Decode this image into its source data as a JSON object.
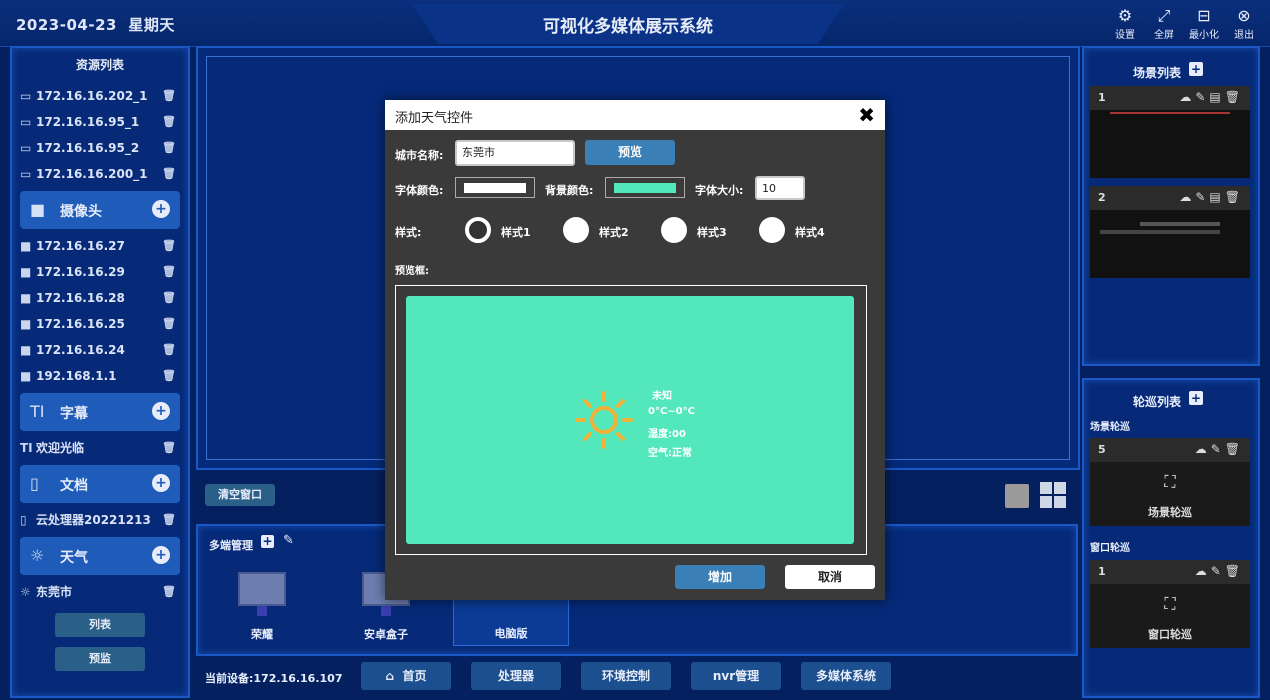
{
  "header": {
    "date": "2023-04-23",
    "weekday": "星期天",
    "title": "可视化多媒体展示系统",
    "buttons": [
      {
        "label": "设置",
        "icon": "gear-icon"
      },
      {
        "label": "全屏",
        "icon": "fullscreen-icon"
      },
      {
        "label": "最小化",
        "icon": "minimize-icon"
      },
      {
        "label": "退出",
        "icon": "close-icon"
      }
    ]
  },
  "left": {
    "title": "资源列表",
    "devices": [
      "172.16.16.202_1",
      "172.16.16.95_1",
      "172.16.16.95_2",
      "172.16.16.200_1"
    ],
    "camera_label": "摄像头",
    "cameras": [
      "172.16.16.27",
      "172.16.16.29",
      "172.16.16.28",
      "172.16.16.25",
      "172.16.16.24",
      "192.168.1.1"
    ],
    "subtitle_label": "字幕",
    "subtitles": [
      "欢迎光临"
    ],
    "doc_label": "文档",
    "docs": [
      "云处理器20221213"
    ],
    "weather_label": "天气",
    "weathers": [
      "东莞市"
    ],
    "list_btn": "列表",
    "preview_btn": "预监"
  },
  "center": {
    "clear_btn": "清空窗口",
    "multi_title": "多端管理",
    "devices": [
      "荣耀",
      "安卓盒子",
      "电脑版"
    ],
    "current_device": "当前设备:172.16.16.107"
  },
  "nav": [
    "首页",
    "处理器",
    "环境控制",
    "nvr管理",
    "多媒体系统"
  ],
  "dialog": {
    "title": "添加天气控件",
    "city_label": "城市名称:",
    "city_value": "东莞市",
    "preview_btn": "预览",
    "font_color_label": "字体颜色:",
    "font_color": "#ffffff",
    "bg_color_label": "背景颜色:",
    "bg_color": "#52e8bb",
    "font_size_label": "字体大小:",
    "font_size": "10",
    "style_label": "样式:",
    "styles": [
      "样式1",
      "样式2",
      "样式3",
      "样式4"
    ],
    "selected_style": 0,
    "preview_frame_label": "预览框:",
    "weather": {
      "condition": "未知",
      "temp": "0°C~0°C",
      "humidity": "湿度:00",
      "air": "空气:正常"
    },
    "add_btn": "增加",
    "cancel_btn": "取消"
  },
  "right": {
    "scene_title": "场景列表",
    "scenes": [
      "1",
      "2"
    ],
    "tour_title": "轮巡列表",
    "scene_tour_label": "场景轮巡",
    "scene_tour_num": "5",
    "scene_tour_name": "场景轮巡",
    "window_tour_label": "窗口轮巡",
    "window_tour_num": "1",
    "window_tour_name": "窗口轮巡"
  },
  "colors": {
    "accent": "#1a58c8",
    "background": "#04205e",
    "weather_bg": "#52e8bb",
    "sun": "#f2b23a"
  }
}
